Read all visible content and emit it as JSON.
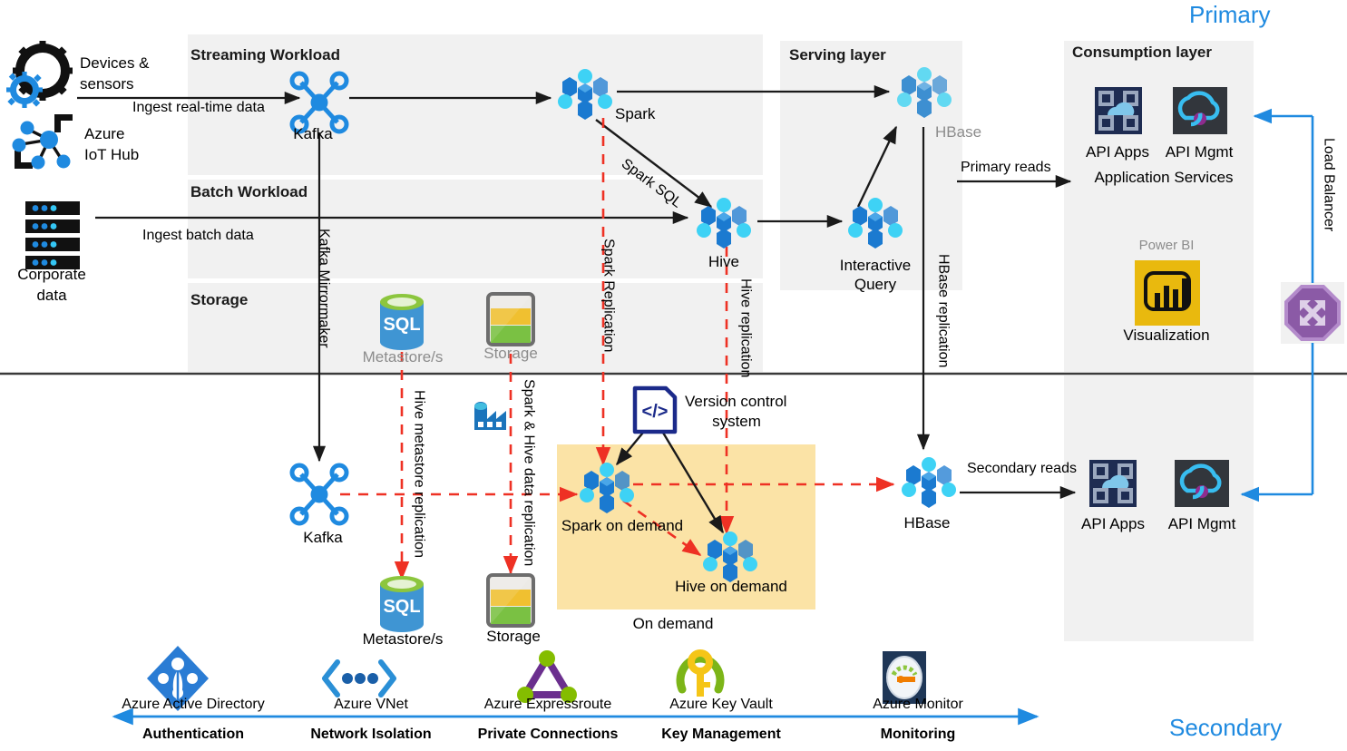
{
  "regions": {
    "primary_label": "Primary",
    "secondary_label": "Secondary"
  },
  "swimlanes": [
    {
      "id": "streaming",
      "title": "Streaming Workload"
    },
    {
      "id": "batch",
      "title": "Batch Workload"
    },
    {
      "id": "storage",
      "title": "Storage"
    }
  ],
  "panels": {
    "serving_layer": "Serving layer",
    "consumption_layer": "Consumption layer"
  },
  "sources": [
    {
      "id": "devices",
      "label": "Devices &\nsensors",
      "line1": "Devices &",
      "line2": "sensors",
      "icon": "gear-sensors-icon"
    },
    {
      "id": "iothub",
      "label": "Azure\nIoT Hub",
      "line1": "Azure",
      "line2": "IoT Hub",
      "icon": "azure-iot-hub-icon"
    },
    {
      "id": "corporate",
      "label": "Corporate\ndata",
      "line1": "Corporate",
      "line2": "data",
      "icon": "server-rack-icon"
    }
  ],
  "primary_nodes": {
    "kafka": "Kafka",
    "spark": "Spark",
    "hive": "Hive",
    "interactive_query_l1": "Interactive",
    "interactive_query_l2": "Query",
    "hbase": "HBase",
    "metastore": "Metastore/s",
    "storage": "Storage"
  },
  "secondary_nodes": {
    "kafka": "Kafka",
    "metastore": "Metastore/s",
    "storage": "Storage",
    "spark_on_demand": "Spark on demand",
    "hive_on_demand": "Hive on demand",
    "on_demand_group": "On demand",
    "hbase": "HBase",
    "version_control_l1": "Version control",
    "version_control_l2": "system",
    "data_factory": "data-factory-icon"
  },
  "consumption": {
    "primary": {
      "api_apps": "API Apps",
      "api_mgmt": "API Mgmt",
      "application_services": "Application Services",
      "power_bi": "Power BI",
      "visualization": "Visualization"
    },
    "secondary": {
      "api_apps": "API Apps",
      "api_mgmt": "API  Mgmt"
    }
  },
  "edge_labels": {
    "ingest_realtime": "Ingest real-time data",
    "ingest_batch": "Ingest batch data",
    "spark_sql": "Spark SQL",
    "primary_reads": "Primary reads",
    "secondary_reads": "Secondary reads",
    "kafka_mirrormaker": "Kafka Mirrormaker",
    "spark_replication": "Spark Replication",
    "hive_replication": "Hive replication",
    "hbase_replication": "HBase replication",
    "hive_metastore_replication": "Hive metastore replication",
    "spark_hive_data_replication": "Spark & Hive data  replication",
    "load_balancer": "Load Balancer"
  },
  "footer": {
    "services": [
      {
        "name": "Azure Active Directory",
        "capability": "Authentication",
        "icon": "azure-active-directory-icon"
      },
      {
        "name": "Azure VNet",
        "capability": "Network Isolation",
        "icon": "azure-vnet-icon"
      },
      {
        "name": "Azure Expressroute",
        "capability": "Private Connections",
        "icon": "azure-expressroute-icon"
      },
      {
        "name": "Azure Key Vault",
        "capability": "Key Management",
        "icon": "azure-key-vault-icon"
      },
      {
        "name": "Azure Monitor",
        "capability": "Monitoring",
        "icon": "azure-monitor-icon"
      }
    ]
  },
  "colors": {
    "panel_grey": "#f1f1f1",
    "on_demand_yellow": "#fbe3a6",
    "replication_red": "#ee3124",
    "azure_blue": "#1f8ae0",
    "accent_blue": "#0f7ad0",
    "power_bi_yellow": "#e9b90e",
    "load_balancer_purple": "#8b5aa6"
  }
}
